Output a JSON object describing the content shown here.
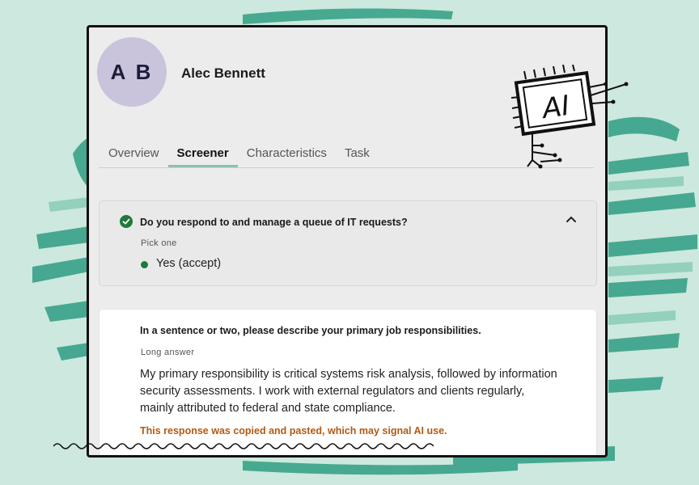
{
  "profile": {
    "initials": "A B",
    "name": "Alec Bennett"
  },
  "tabs": [
    {
      "label": "Overview",
      "active": false
    },
    {
      "label": "Screener",
      "active": true
    },
    {
      "label": "Characteristics",
      "active": false
    },
    {
      "label": "Task",
      "active": false
    }
  ],
  "questions": [
    {
      "title": "Do you respond to and manage a queue of IT requests?",
      "type_label": "Pick one",
      "answer": "Yes (accept)",
      "status_icon": "check-circle-icon",
      "collapse_icon": "chevron-up-icon"
    },
    {
      "title": "In a sentence or two, please describe your primary job responsibilities.",
      "type_label": "Long answer",
      "answer": "My primary responsibility is critical systems risk analysis, followed by information security assessments. I work with external regulators and clients regularly, mainly attributed to federal and state compliance.",
      "warning": "This response was copied and pasted, which may signal AI use."
    }
  ],
  "ai_badge": {
    "text": "AI",
    "icon": "ai-chip-icon"
  },
  "colors": {
    "background": "#cde8de",
    "brush_strokes": "#2f9e83",
    "accent_tab_underline": "#8cc1b1",
    "success": "#1e7a3c",
    "warning": "#b15a12",
    "avatar": "#c9c4dc"
  }
}
